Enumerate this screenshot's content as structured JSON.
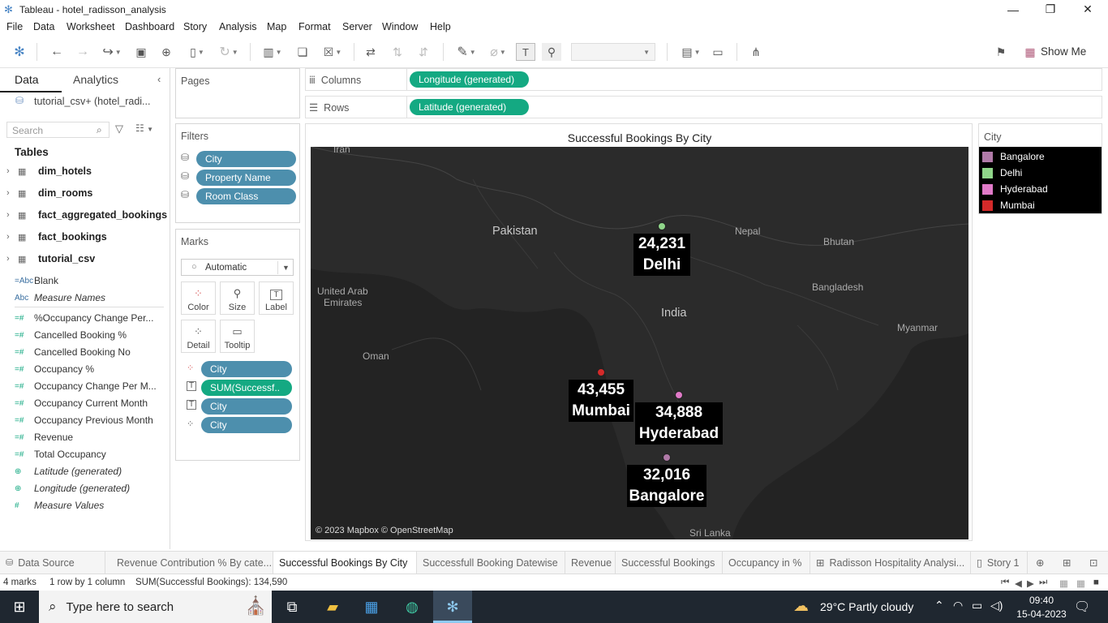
{
  "window": {
    "title": "Tableau - hotel_radisson_analysis"
  },
  "menu": [
    "File",
    "Data",
    "Worksheet",
    "Dashboard",
    "Story",
    "Analysis",
    "Map",
    "Format",
    "Server",
    "Window",
    "Help"
  ],
  "toolbar": {
    "show_me": "Show Me"
  },
  "left_pane": {
    "tab_data": "Data",
    "tab_analytics": "Analytics",
    "data_source": "tutorial_csv+ (hotel_radi...",
    "search_placeholder": "Search",
    "tables_heading": "Tables",
    "tables": [
      "dim_hotels",
      "dim_rooms",
      "fact_aggregated_bookings",
      "fact_bookings",
      "tutorial_csv"
    ],
    "fields": [
      {
        "icon": "=Abc",
        "name": "Blank",
        "italic": false
      },
      {
        "icon": "Abc",
        "name": "Measure Names",
        "italic": true
      },
      {
        "icon": "=#",
        "name": "%Occupancy  Change Per...",
        "italic": false
      },
      {
        "icon": "=#",
        "name": "Cancelled Booking %",
        "italic": false
      },
      {
        "icon": "=#",
        "name": "Cancelled Booking No",
        "italic": false
      },
      {
        "icon": "=#",
        "name": "Occupancy %",
        "italic": false
      },
      {
        "icon": "=#",
        "name": "Occupancy Change Per M...",
        "italic": false
      },
      {
        "icon": "=#",
        "name": "Occupancy Current Month",
        "italic": false
      },
      {
        "icon": "=#",
        "name": "Occupancy Previous Month",
        "italic": false
      },
      {
        "icon": "=#",
        "name": "Revenue",
        "italic": false
      },
      {
        "icon": "=#",
        "name": "Total Occupancy",
        "italic": false
      },
      {
        "icon": "globe",
        "name": "Latitude (generated)",
        "italic": true
      },
      {
        "icon": "globe",
        "name": "Longitude (generated)",
        "italic": true
      },
      {
        "icon": "#",
        "name": "Measure Values",
        "italic": true
      }
    ]
  },
  "pages": {
    "heading": "Pages"
  },
  "filters": {
    "heading": "Filters",
    "items": [
      "City",
      "Property Name",
      "Room Class"
    ]
  },
  "marks": {
    "heading": "Marks",
    "type": "Automatic",
    "buttons": [
      "Color",
      "Size",
      "Label",
      "Detail",
      "Tooltip"
    ],
    "pills": [
      {
        "label": "City",
        "color": "blue"
      },
      {
        "label": "SUM(Successf..",
        "color": "green"
      },
      {
        "label": "City",
        "color": "blue"
      },
      {
        "label": "City",
        "color": "blue"
      }
    ]
  },
  "shelves": {
    "columns_label": "Columns",
    "columns_pill": "Longitude (generated)",
    "rows_label": "Rows",
    "rows_pill": "Latitude (generated)"
  },
  "viz": {
    "title": "Successful Bookings By City",
    "attribution": "© 2023 Mapbox © OpenStreetMap",
    "map_labels": [
      "Iran",
      "Pakistan",
      "Nepal",
      "Bhutan",
      "United Arab",
      "Emirates",
      "Bangladesh",
      "India",
      "Myanmar",
      "Oman",
      "Sri Lanka"
    ],
    "points": [
      {
        "city": "Delhi",
        "value": "24,231",
        "color": "#90d68a"
      },
      {
        "city": "Mumbai",
        "value": "43,455",
        "color": "#d42a2a"
      },
      {
        "city": "Hyderabad",
        "value": "34,888",
        "color": "#e07ac8"
      },
      {
        "city": "Bangalore",
        "value": "32,016",
        "color": "#b07aa8"
      }
    ]
  },
  "legend": {
    "heading": "City",
    "items": [
      {
        "label": "Bangalore",
        "color": "#b07aa8"
      },
      {
        "label": "Delhi",
        "color": "#90d68a"
      },
      {
        "label": "Hyderabad",
        "color": "#e07ac8"
      },
      {
        "label": "Mumbai",
        "color": "#d42a2a"
      }
    ]
  },
  "sheet_tabs": [
    {
      "label": "Data Source",
      "active": false
    },
    {
      "label": "Revenue Contribution % By cate...",
      "active": false
    },
    {
      "label": "Successful Bookings By City",
      "active": true
    },
    {
      "label": "Successfull Booking Datewise",
      "active": false
    },
    {
      "label": "Revenue",
      "active": false
    },
    {
      "label": "Successful Bookings",
      "active": false
    },
    {
      "label": "Occupancy in %",
      "active": false
    },
    {
      "label": "Radisson Hospitality Analysi...",
      "active": false
    },
    {
      "label": "Story 1",
      "active": false
    }
  ],
  "status": {
    "marks": "4 marks",
    "dims": "1 row by 1 column",
    "sum": "SUM(Successful Bookings): 134,590"
  },
  "taskbar": {
    "search_placeholder": "Type here to search",
    "weather": "29°C  Partly cloudy",
    "time": "09:40",
    "date": "15-04-2023"
  }
}
